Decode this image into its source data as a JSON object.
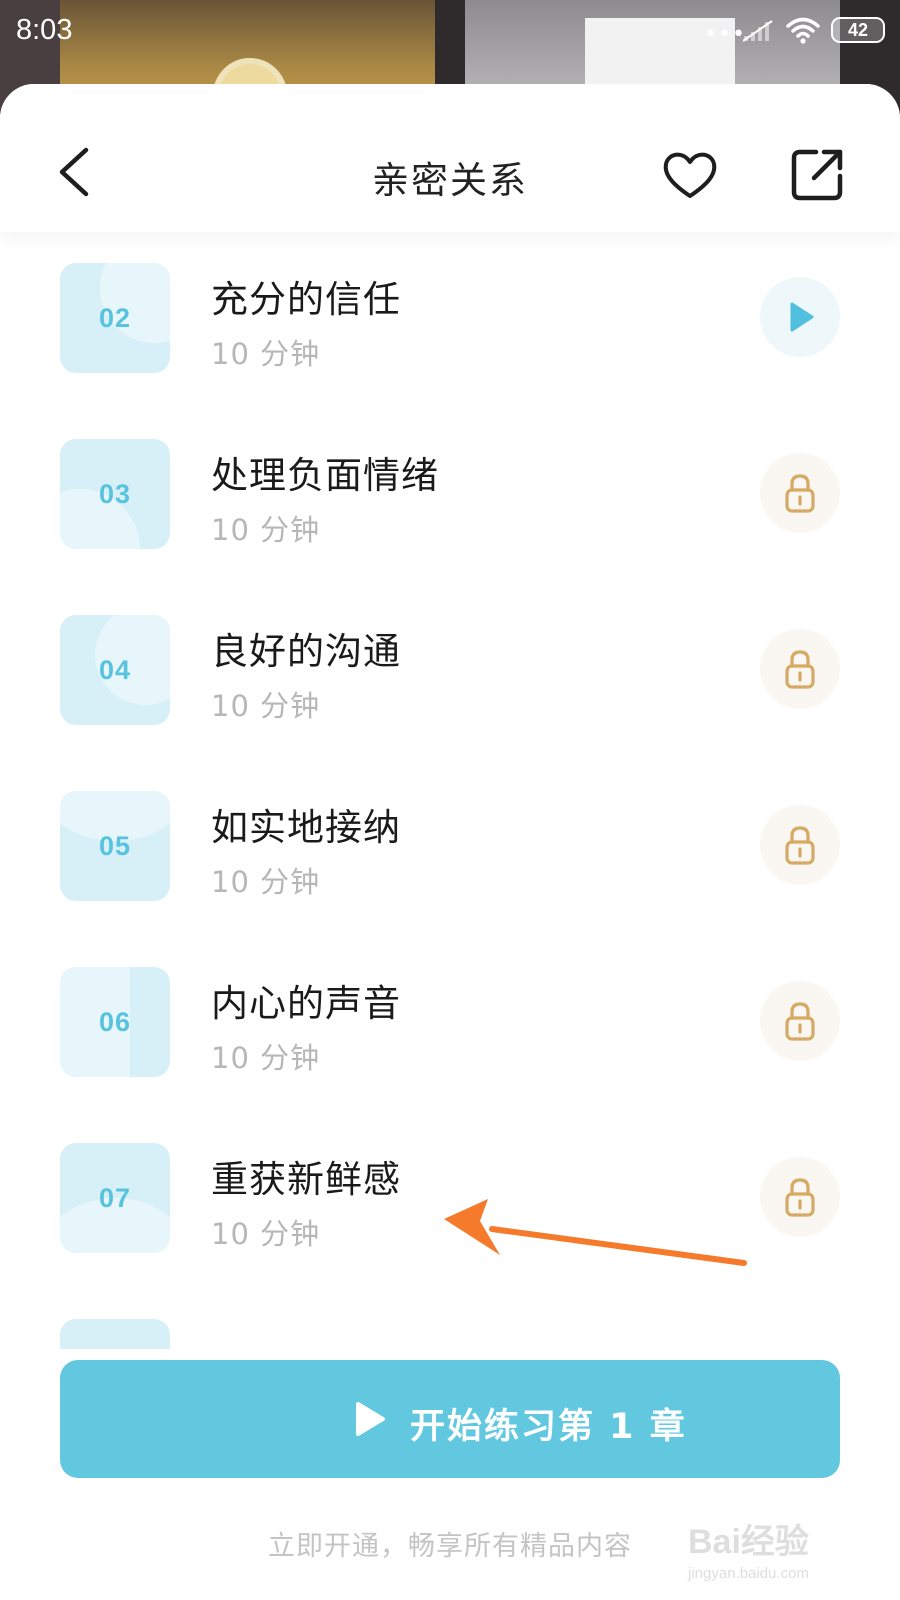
{
  "status_bar": {
    "time": "8:03",
    "dots": "•••",
    "battery": "42"
  },
  "header": {
    "title": "亲密关系",
    "back_icon": "chevron-left-icon",
    "favorite_icon": "heart-outline-icon",
    "share_icon": "share-external-icon"
  },
  "lessons": [
    {
      "num": "02",
      "title": "充分的信任",
      "duration": "10 分钟",
      "status": "play"
    },
    {
      "num": "03",
      "title": "处理负面情绪",
      "duration": "10 分钟",
      "status": "locked"
    },
    {
      "num": "04",
      "title": "良好的沟通",
      "duration": "10 分钟",
      "status": "locked"
    },
    {
      "num": "05",
      "title": "如实地接纳",
      "duration": "10 分钟",
      "status": "locked"
    },
    {
      "num": "06",
      "title": "内心的声音",
      "duration": "10 分钟",
      "status": "locked"
    },
    {
      "num": "07",
      "title": "重获新鲜感",
      "duration": "10 分钟",
      "status": "locked"
    }
  ],
  "start_button": {
    "label": "开始练习第 1 章"
  },
  "promo_text": "立即开通，畅享所有精品内容",
  "watermark": {
    "logo": "Bai经验",
    "url": "jingyan.baidu.com"
  },
  "colors": {
    "accent": "#62c8e0",
    "play_icon": "#4fc0de",
    "lock_icon": "#d6a964",
    "annotation_arrow": "#f57a2b",
    "thumb_bg": "#d7f0f7"
  }
}
